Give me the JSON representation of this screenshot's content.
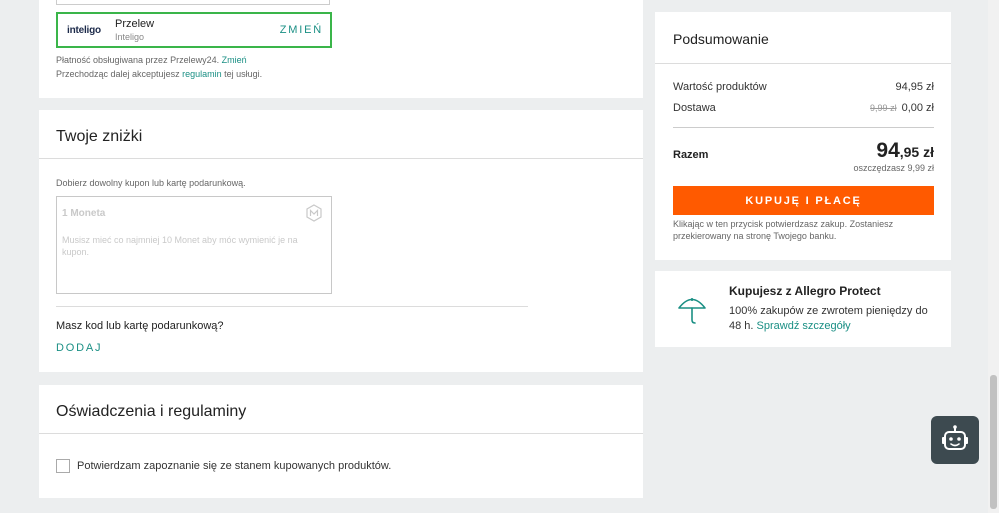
{
  "payment": {
    "option_logo": "inteligo",
    "option_title": "Przelew",
    "option_subtitle": "Inteligo",
    "change_label": "ZMIEŃ",
    "handled_text": "Płatność obsługiwana przez Przelewy24.",
    "handled_link": "Zmień",
    "terms_prefix": "Przechodząc dalej akceptujesz",
    "terms_link": "regulamin",
    "terms_suffix": "tej usługi."
  },
  "discounts": {
    "title": "Twoje zniżki",
    "hint": "Dobierz dowolny kupon lub kartę podarunkową.",
    "coupon_title": "1 Moneta",
    "coupon_desc": "Musisz mieć co najmniej 10 Monet aby móc wymienić je na kupon.",
    "have_code": "Masz kod lub kartę podarunkową?",
    "add_label": "DODAJ"
  },
  "statements": {
    "title": "Oświadczenia i regulaminy",
    "checkbox_label": "Potwierdzam zapoznanie się ze stanem kupowanych produktów.",
    "checkbox_checked": false
  },
  "summary": {
    "title": "Podsumowanie",
    "products_label": "Wartość produktów",
    "products_value": "94,95 zł",
    "delivery_label": "Dostawa",
    "delivery_old": "9,99 zł",
    "delivery_value": "0,00 zł",
    "total_label": "Razem",
    "total_int": "94",
    "total_frac": ",95 zł",
    "savings": "oszczędzasz 9,99 zł",
    "buy_label": "KUPUJĘ I PŁACĘ",
    "buy_note": "Klikając w ten przycisk potwierdzasz zakup. Zostaniesz przekierowany na stronę Twojego banku.",
    "accent_color": "#ff5a00"
  },
  "protect": {
    "title": "Kupujesz z Allegro Protect",
    "desc": "100% zakupów ze zwrotem pieniędzy do 48 h.",
    "link": "Sprawdź szczegóły",
    "icon": "umbrella-icon",
    "icon_color": "#1a8f84"
  },
  "chatbot": {
    "icon": "robot-icon"
  }
}
